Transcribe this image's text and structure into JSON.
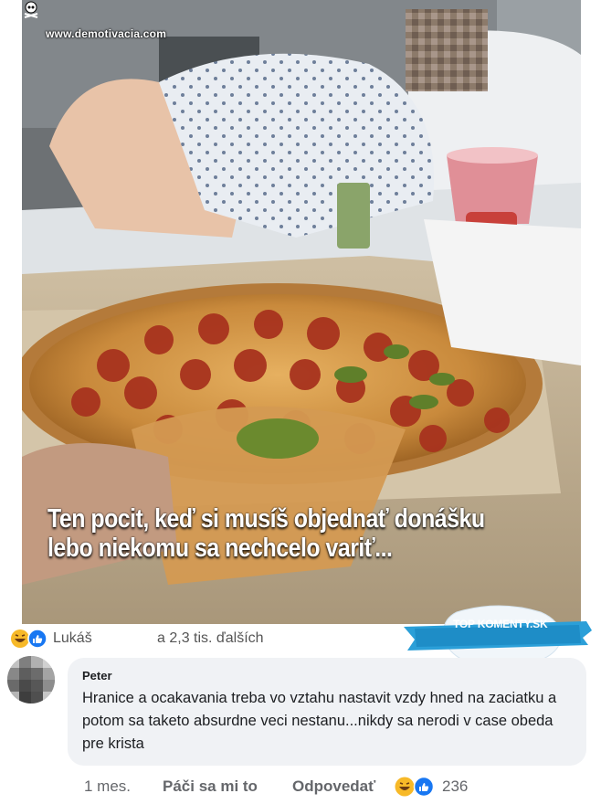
{
  "post": {
    "watermark": "www.demotivacia.com",
    "caption_line1": "Ten pocit, keď si musíš objednať donášku",
    "caption_line2": "lebo niekomu sa nechcelo variť..."
  },
  "reactions": {
    "icons": [
      "laugh-emoji-icon",
      "like-thumb-icon"
    ],
    "first_name": "Lukáš",
    "others": "a 2,3 tis. ďalších"
  },
  "badge": {
    "text": "TOP KOMENTY.SK",
    "color": "#2b9fd8"
  },
  "comment": {
    "author": "Peter",
    "text": "Hranice a ocakavania treba vo vztahu nastavit vzdy hned na zaciatku a potom sa taketo absurdne veci nestanu...nikdy sa nerodi v case obeda pre krista",
    "time": "1 mes.",
    "like_label": "Páči sa mi to",
    "reply_label": "Odpovedať",
    "reaction_count": "236"
  },
  "colors": {
    "bubble_bg": "#f0f2f5",
    "meta_text": "#65676b",
    "like_blue": "#1877f2",
    "laugh_yellow": "#f7b928"
  }
}
